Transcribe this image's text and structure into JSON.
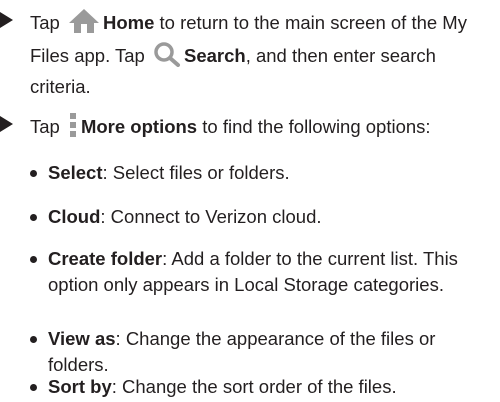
{
  "para1": {
    "pre": "Tap ",
    "home_label": "Home",
    "mid": " to return to the main screen of the My Files app. Tap ",
    "search_label": "Search",
    "post": ", and then enter search criteria."
  },
  "para2": {
    "pre": "Tap ",
    "more_label": "More options",
    "post": " to find the following options:"
  },
  "options": [
    {
      "term": "Select",
      "desc": ": Select files or folders."
    },
    {
      "term": "Cloud",
      "desc": ": Connect to Verizon cloud."
    },
    {
      "term": "Create folder",
      "desc": ": Add a folder to the current list. This option only appears in Local Storage categories."
    },
    {
      "term": "View as",
      "desc": ": Change the appearance of the files or folders."
    },
    {
      "term": "Sort by",
      "desc": ": Change the sort order of the files."
    }
  ],
  "icons": {
    "home": "home-icon",
    "search": "search-icon",
    "more": "more-options-icon"
  },
  "colors": {
    "text": "#231f20",
    "icon": "#9a9a9a"
  }
}
